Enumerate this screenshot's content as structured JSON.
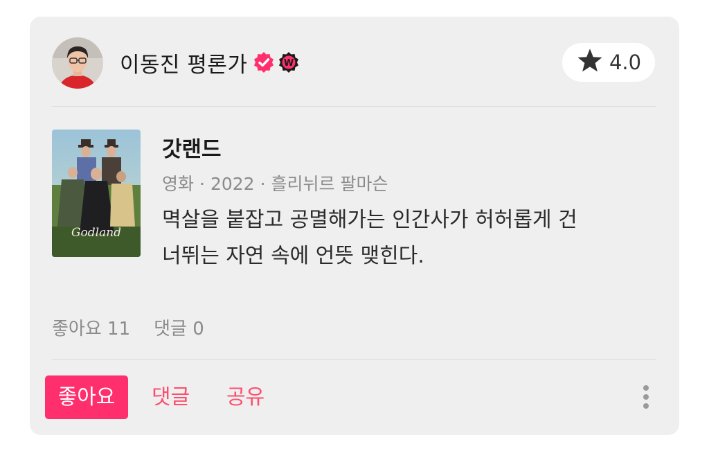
{
  "colors": {
    "accent": "#ff2f6e",
    "accent_text": "#ff4d6d",
    "card_bg": "#efefef",
    "muted": "#8b8b8b"
  },
  "header": {
    "author_name": "이동진 평론가",
    "verified_icon": "verified-badge-icon",
    "partner_icon": "w-badge-icon",
    "partner_badge_letter": "W",
    "rating_icon": "star-icon",
    "rating_value": "4.0"
  },
  "movie": {
    "title": "갓랜드",
    "category": "영화",
    "year": "2022",
    "director": "흘리뉘르 팔마슨",
    "separator": "·",
    "poster_title": "Godland"
  },
  "review": {
    "line1": "멱살을 붙잡고 공멸해가는 인간사가 허허롭게 건",
    "line2": "너뛰는 자연 속에 언뜻 맺힌다."
  },
  "stats": {
    "likes": "좋아요 11",
    "comments": "댓글 0"
  },
  "actions": {
    "like_label": "좋아요",
    "comment_label": "댓글",
    "share_label": "공유",
    "more_icon": "more-vertical-icon"
  }
}
